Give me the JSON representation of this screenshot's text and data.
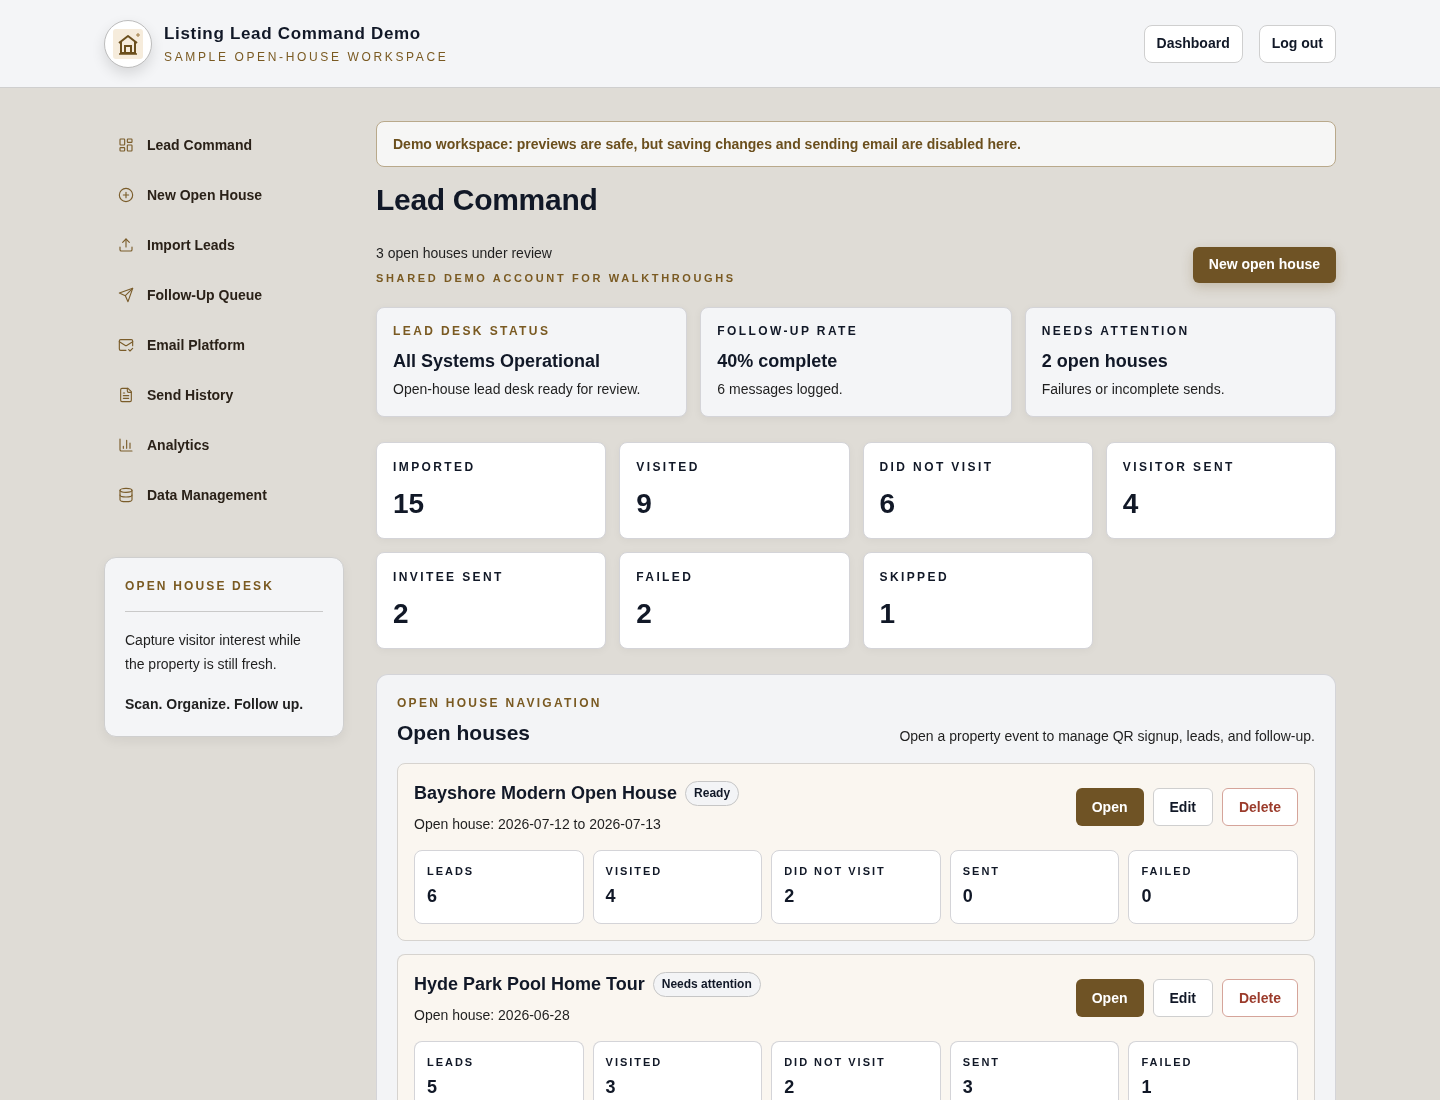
{
  "header": {
    "title": "Listing Lead Command Demo",
    "subtitle": "SAMPLE OPEN-HOUSE WORKSPACE",
    "buttons": [
      "Dashboard",
      "Log out"
    ]
  },
  "sidebar": {
    "items": [
      {
        "label": "Lead Command"
      },
      {
        "label": "New Open House"
      },
      {
        "label": "Import Leads"
      },
      {
        "label": "Follow-Up Queue"
      },
      {
        "label": "Email Platform"
      },
      {
        "label": "Send History"
      },
      {
        "label": "Analytics"
      },
      {
        "label": "Data Management"
      }
    ],
    "desk_card": {
      "title": "OPEN HOUSE DESK",
      "text": "Capture visitor interest while the property is still fresh.",
      "tagline": "Scan. Organize. Follow up."
    }
  },
  "notice": "Demo workspace: previews are safe, but saving changes and sending email are disabled here.",
  "page": {
    "title": "Lead Command",
    "summary": "3 open houses under review",
    "note": "SHARED DEMO ACCOUNT FOR WALKTHROUGHS",
    "action": "New open house"
  },
  "status_cards": [
    {
      "label": "LEAD DESK STATUS",
      "color": "#7a5a22",
      "value": "All Systems Operational",
      "detail": "Open-house lead desk ready for review."
    },
    {
      "label": "FOLLOW-UP RATE",
      "color": "#111827",
      "value": "40% complete",
      "detail": "6 messages logged."
    },
    {
      "label": "NEEDS ATTENTION",
      "color": "#111827",
      "value": "2 open houses",
      "detail": "Failures or incomplete sends."
    }
  ],
  "stats": [
    {
      "label": "IMPORTED",
      "value": "15"
    },
    {
      "label": "VISITED",
      "value": "9"
    },
    {
      "label": "DID NOT VISIT",
      "value": "6"
    },
    {
      "label": "VISITOR SENT",
      "value": "4"
    },
    {
      "label": "INVITEE SENT",
      "value": "2"
    },
    {
      "label": "FAILED",
      "value": "2"
    },
    {
      "label": "SKIPPED",
      "value": "1"
    }
  ],
  "open_houses": {
    "eyebrow": "OPEN HOUSE NAVIGATION",
    "title": "Open houses",
    "hint": "Open a property event to manage QR signup, leads, and follow-up.",
    "events": [
      {
        "name": "Bayshore Modern Open House",
        "status": "Ready",
        "dates": "Open house: 2026-07-12 to 2026-07-13",
        "actions": [
          {
            "label": "Open",
            "kind": "primary"
          },
          {
            "label": "Edit",
            "kind": "secondary"
          },
          {
            "label": "Delete",
            "kind": "danger"
          }
        ],
        "stats": [
          {
            "label": "LEADS",
            "value": "6"
          },
          {
            "label": "VISITED",
            "value": "4"
          },
          {
            "label": "DID NOT VISIT",
            "value": "2"
          },
          {
            "label": "SENT",
            "value": "0"
          },
          {
            "label": "FAILED",
            "value": "0"
          }
        ]
      },
      {
        "name": "Hyde Park Pool Home Tour",
        "status": "Needs attention",
        "dates": "Open house: 2026-06-28",
        "actions": [
          {
            "label": "Open",
            "kind": "primary"
          },
          {
            "label": "Edit",
            "kind": "secondary"
          },
          {
            "label": "Delete",
            "kind": "danger"
          }
        ],
        "stats": [
          {
            "label": "LEADS",
            "value": "5"
          },
          {
            "label": "VISITED",
            "value": "3"
          },
          {
            "label": "DID NOT VISIT",
            "value": "2"
          },
          {
            "label": "SENT",
            "value": "3"
          },
          {
            "label": "FAILED",
            "value": "1"
          }
        ]
      }
    ]
  }
}
